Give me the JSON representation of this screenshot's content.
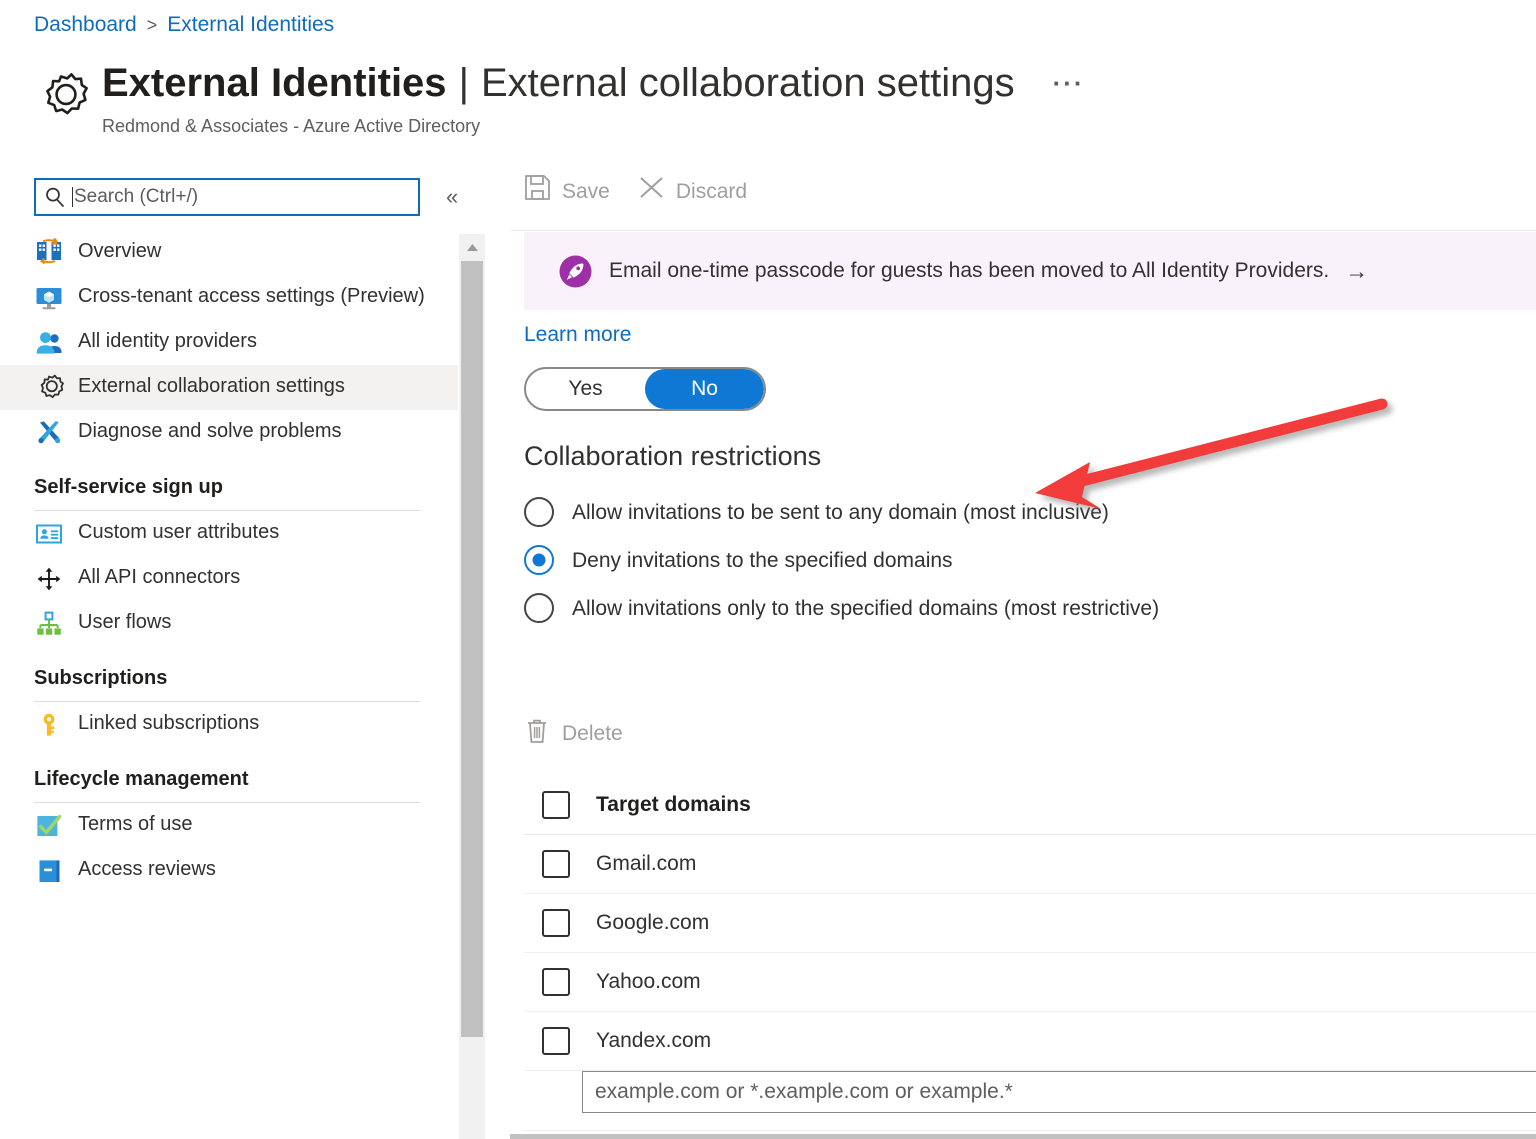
{
  "breadcrumb": {
    "items": [
      "Dashboard",
      "External Identities"
    ],
    "separator": ">"
  },
  "header": {
    "title_strong": "External Identities",
    "title_separator": "|",
    "title_rest": "External collaboration settings",
    "subtitle": "Redmond & Associates - Azure Active Directory",
    "more_menu": "···",
    "gear_icon": "gear-icon"
  },
  "sidebar": {
    "search": {
      "placeholder": "Search (Ctrl+/)",
      "value": "",
      "icon": "search-icon"
    },
    "collapse": "«",
    "items": [
      {
        "label": "Overview",
        "icon": "overview-icon",
        "selected": false
      },
      {
        "label": "Cross-tenant access settings (Preview)",
        "icon": "monitor-icon",
        "selected": false
      },
      {
        "label": "All identity providers",
        "icon": "users-icon",
        "selected": false
      },
      {
        "label": "External collaboration settings",
        "icon": "gear-icon",
        "selected": true
      },
      {
        "label": "Diagnose and solve problems",
        "icon": "tools-icon",
        "selected": false
      }
    ],
    "groups": [
      {
        "title": "Self-service sign up",
        "items": [
          {
            "label": "Custom user attributes",
            "icon": "id-card-icon"
          },
          {
            "label": "All API connectors",
            "icon": "connectors-icon"
          },
          {
            "label": "User flows",
            "icon": "sitemap-icon"
          }
        ]
      },
      {
        "title": "Subscriptions",
        "items": [
          {
            "label": "Linked subscriptions",
            "icon": "key-icon"
          }
        ]
      },
      {
        "title": "Lifecycle management",
        "items": [
          {
            "label": "Terms of use",
            "icon": "checkmark-icon"
          },
          {
            "label": "Access reviews",
            "icon": "book-icon"
          }
        ]
      }
    ]
  },
  "command_bar": {
    "save_label": "Save",
    "save_icon": "save-icon",
    "discard_label": "Discard",
    "discard_icon": "close-icon"
  },
  "banner": {
    "icon": "rocket-icon",
    "text": "Email one-time passcode for guests has been moved to All Identity Providers.",
    "arrow": "→",
    "background": "#faf2fb",
    "icon_color": "#9e2fa6"
  },
  "learn_more": "Learn more",
  "toggle": {
    "options": [
      "Yes",
      "No"
    ],
    "selected": "No",
    "accent": "#0f78d4"
  },
  "collaboration_restrictions": {
    "heading": "Collaboration restrictions",
    "options": [
      {
        "label": "Allow invitations to be sent to any domain (most inclusive)",
        "checked": false
      },
      {
        "label": "Deny invitations to the specified domains",
        "checked": true
      },
      {
        "label": "Allow invitations only to the specified domains (most restrictive)",
        "checked": false
      }
    ]
  },
  "domains_table": {
    "delete_label": "Delete",
    "delete_icon": "trash-icon",
    "column_header": "Target domains",
    "rows": [
      {
        "domain": "Gmail.com",
        "checked": false
      },
      {
        "domain": "Google.com",
        "checked": false
      },
      {
        "domain": "Yahoo.com",
        "checked": false
      },
      {
        "domain": "Yandex.com",
        "checked": false
      }
    ],
    "new_row_placeholder": "example.com or *.example.com or example.*",
    "new_row_value": ""
  },
  "annotation": {
    "type": "arrow",
    "color": "#f23b3b",
    "points_to": "Collaboration restrictions"
  }
}
